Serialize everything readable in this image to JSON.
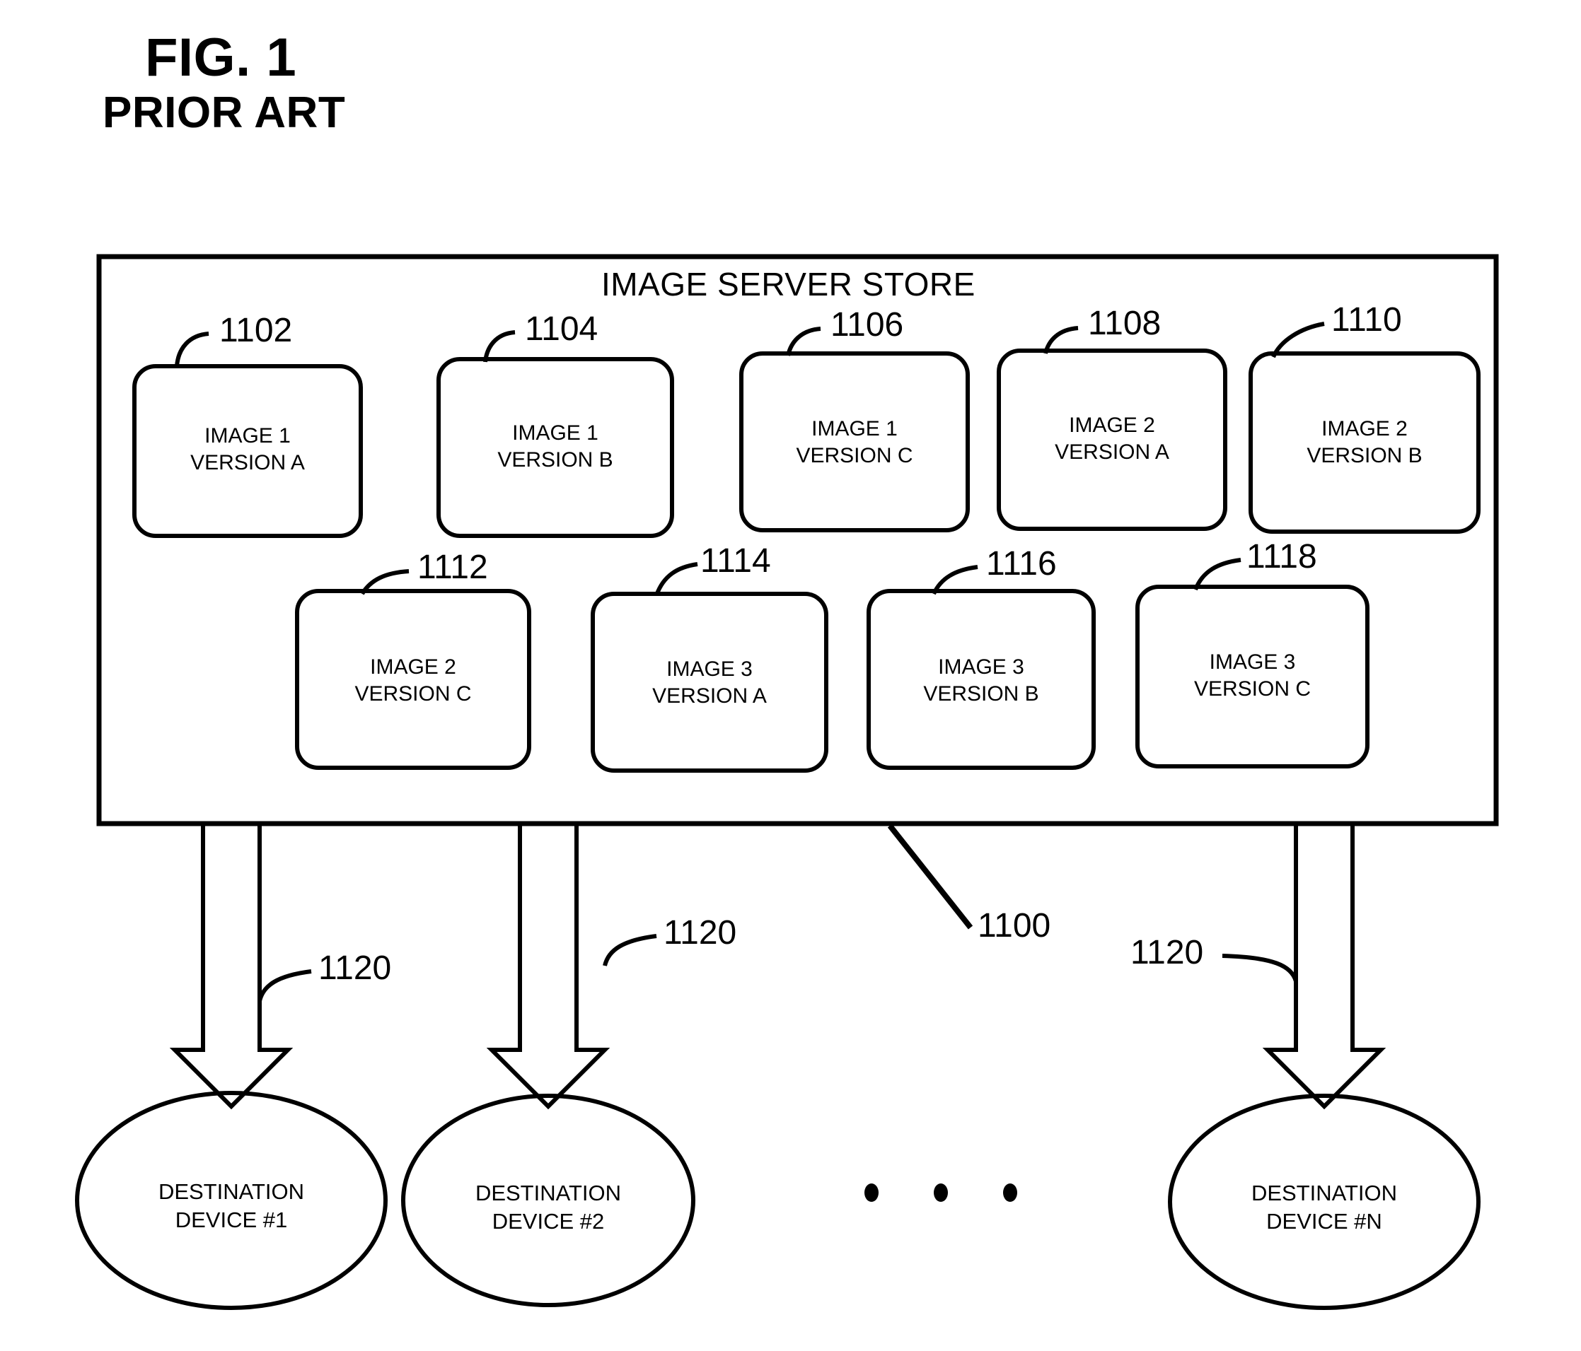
{
  "figure": {
    "title": "FIG. 1",
    "subtitle": "PRIOR ART",
    "store_title": "IMAGE SERVER STORE",
    "store_ref": "1100",
    "line_color": "#000000",
    "background": "#ffffff"
  },
  "image_boxes": [
    {
      "ref": "1102",
      "line1": "IMAGE 1",
      "line2": "VERSION A"
    },
    {
      "ref": "1104",
      "line1": "IMAGE 1",
      "line2": "VERSION B"
    },
    {
      "ref": "1106",
      "line1": "IMAGE 1",
      "line2": "VERSION C"
    },
    {
      "ref": "1108",
      "line1": "IMAGE 2",
      "line2": "VERSION A"
    },
    {
      "ref": "1110",
      "line1": "IMAGE 2",
      "line2": "VERSION B"
    },
    {
      "ref": "1112",
      "line1": "IMAGE 2",
      "line2": "VERSION C"
    },
    {
      "ref": "1114",
      "line1": "IMAGE 3",
      "line2": "VERSION A"
    },
    {
      "ref": "1116",
      "line1": "IMAGE 3",
      "line2": "VERSION B"
    },
    {
      "ref": "1118",
      "line1": "IMAGE 3",
      "line2": "VERSION C"
    }
  ],
  "destinations": [
    {
      "line1": "DESTINATION",
      "line2": "DEVICE #1"
    },
    {
      "line1": "DESTINATION",
      "line2": "DEVICE #2"
    },
    {
      "line1": "DESTINATION",
      "line2": "DEVICE #N"
    }
  ],
  "connectors": [
    {
      "ref": "1120"
    },
    {
      "ref": "1120"
    },
    {
      "ref": "1120"
    }
  ],
  "ellipsis": "• • •"
}
